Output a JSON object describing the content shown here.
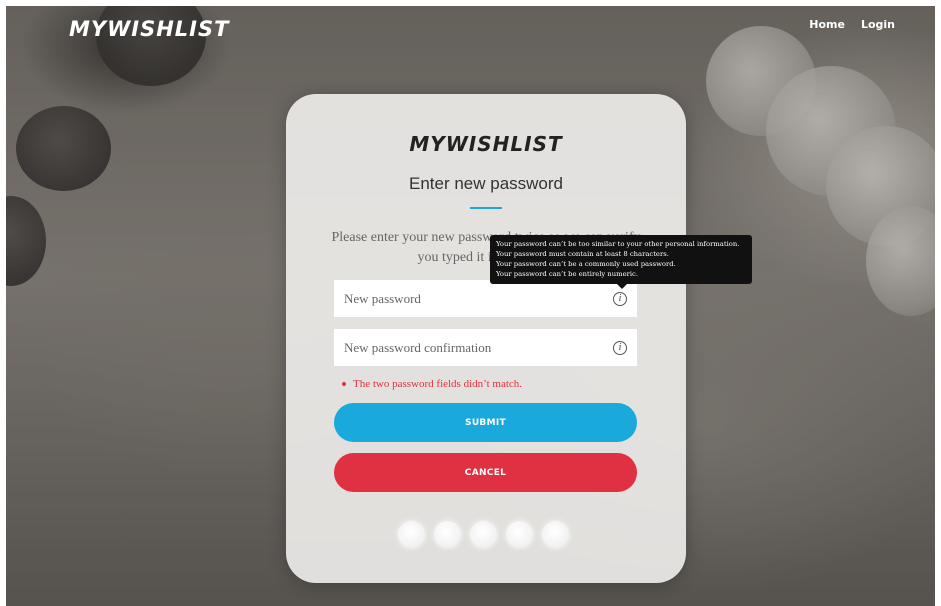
{
  "nav": {
    "logo": "MYWISHLIST",
    "links": [
      "Home",
      "Login"
    ]
  },
  "card": {
    "logo": "MYWISHLIST",
    "title": "Enter new password",
    "instructions": "Please enter your new password twice so we can verify you typed it in correctly."
  },
  "form": {
    "new_password_placeholder": "New password",
    "confirm_password_placeholder": "New password confirmation",
    "info_icon_glyph": "i",
    "error": "The two password fields didn’t match.",
    "submit_label": "SUBMIT",
    "cancel_label": "CANCEL"
  },
  "tooltip": {
    "lines": [
      "Your password can’t be too similar to your other personal information.",
      "Your password must contain at least 8 characters.",
      "Your password can’t be a commonly used password.",
      "Your password can’t be entirely numeric."
    ]
  },
  "colors": {
    "accent": "#1aa9db",
    "danger": "#df3142",
    "error_text": "#e0313f"
  }
}
